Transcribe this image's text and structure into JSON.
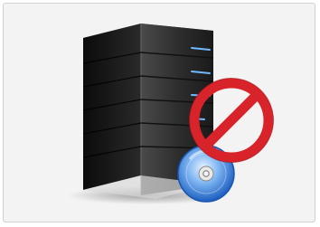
{
  "illustration": {
    "subject": "server-tower-blocked",
    "icons": [
      "server-icon",
      "prohibited-icon",
      "disc-icon"
    ],
    "colors": {
      "background": "#f3f3f3",
      "server_body": "#2b2b2b",
      "server_side": "#111111",
      "drive_light": "#6fb9ff",
      "prohibit_red": "#d8232a",
      "disc_blue": "#1d6fd1"
    }
  }
}
